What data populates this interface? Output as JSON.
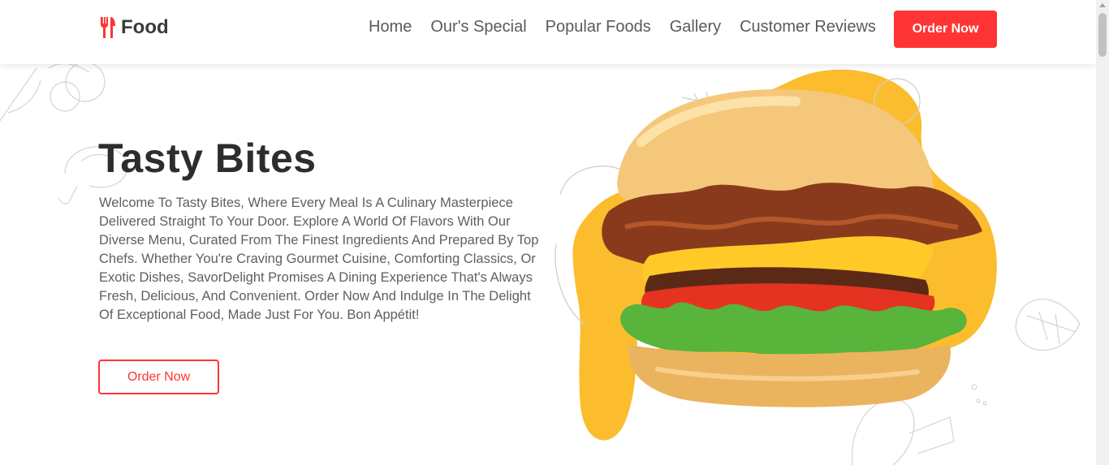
{
  "brand": {
    "name": "Food",
    "icon": "fork-knife-icon"
  },
  "nav": {
    "links": [
      "Home",
      "Our's Special",
      "Popular Foods",
      "Gallery",
      "Customer Reviews"
    ],
    "cta_label": "Order Now"
  },
  "hero": {
    "title": "Tasty Bites",
    "description": "Welcome To Tasty Bites, Where Every Meal Is A Culinary Masterpiece Delivered Straight To Your Door. Explore A World Of Flavors With Our Diverse Menu, Curated From The Finest Ingredients And Prepared By Top Chefs. Whether You're Craving Gourmet Cuisine, Comforting Classics, Or Exotic Dishes, SavorDelight Promises A Dining Experience That's Always Fresh, Delicious, And Convenient. Order Now And Indulge In The Delight Of Exceptional Food, Made Just For You. Bon Appétit!",
    "cta_label": "Order Now",
    "image": "burger-illustration"
  },
  "colors": {
    "accent": "#ff3434",
    "yellow_blob": "#fbbd2e",
    "text": "#2d2d2d",
    "muted": "#5f5f5f"
  }
}
